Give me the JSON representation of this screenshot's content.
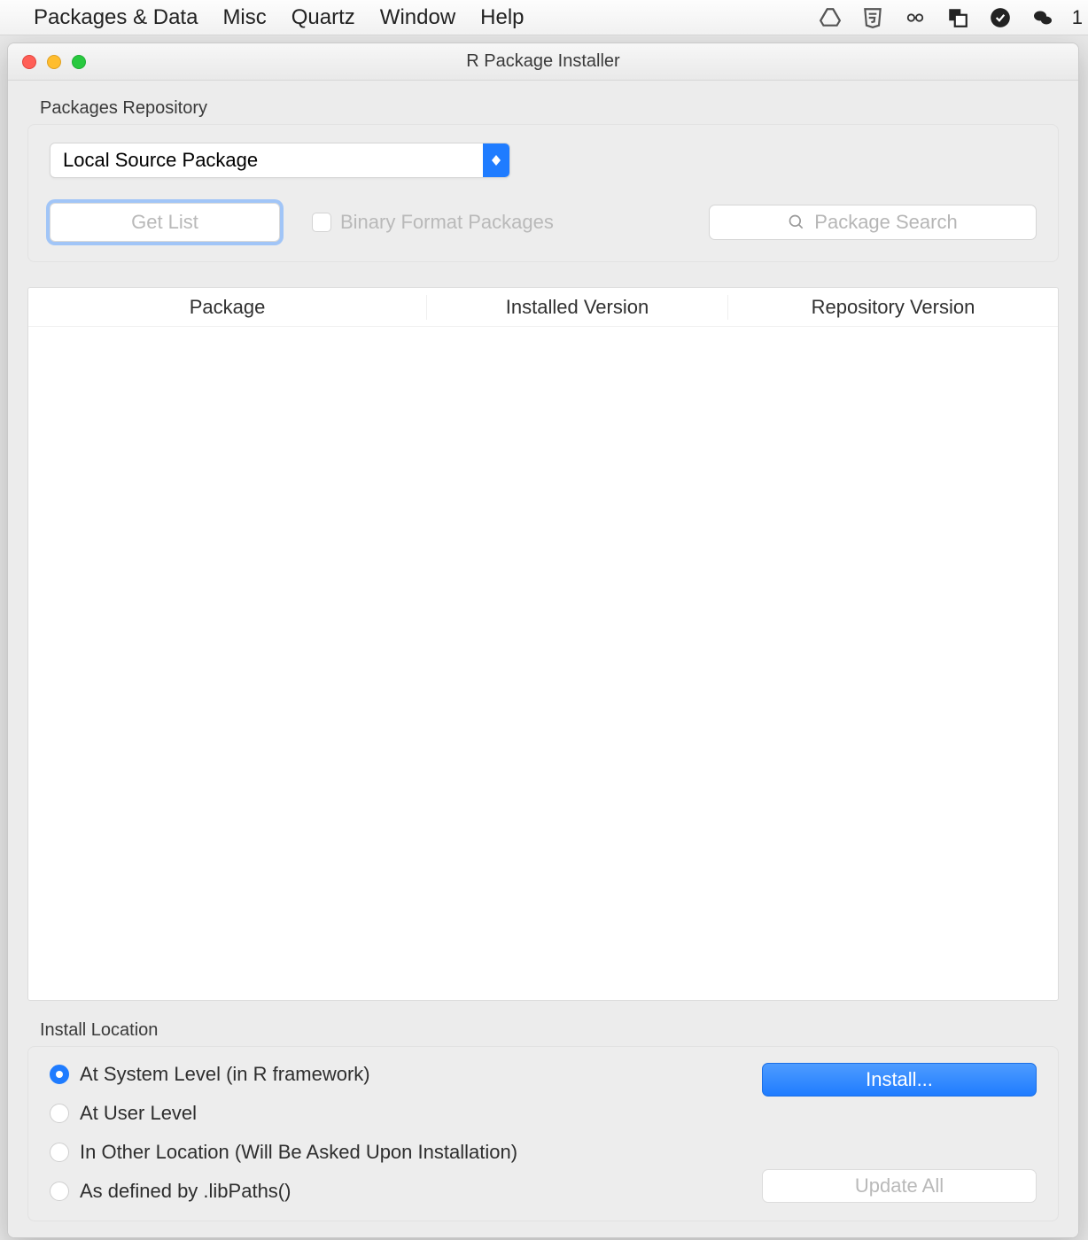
{
  "menubar": {
    "items": [
      "Packages & Data",
      "Misc",
      "Quartz",
      "Window",
      "Help"
    ],
    "right_badge": "1"
  },
  "window": {
    "title": "R Package Installer"
  },
  "repo": {
    "label": "Packages Repository",
    "select_value": "Local Source Package",
    "getlist_label": "Get List",
    "checkbox_label": "Binary Format Packages",
    "search_placeholder": "Package Search"
  },
  "table": {
    "columns": [
      "Package",
      "Installed Version",
      "Repository Version"
    ],
    "rows": []
  },
  "install": {
    "label": "Install Location",
    "options": [
      {
        "label": "At System Level (in R framework)",
        "selected": true
      },
      {
        "label": "At User Level",
        "selected": false
      },
      {
        "label": "In Other Location (Will Be Asked Upon Installation)",
        "selected": false
      },
      {
        "label": "As defined by .libPaths()",
        "selected": false
      }
    ],
    "install_label": "Install...",
    "update_label": "Update All"
  }
}
